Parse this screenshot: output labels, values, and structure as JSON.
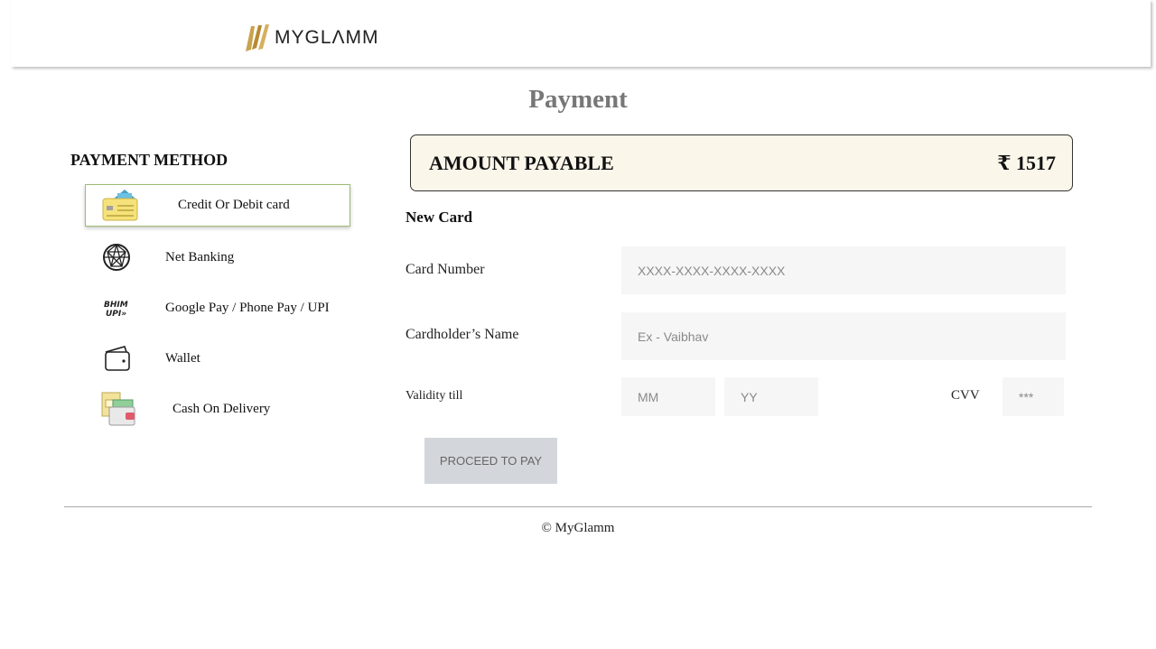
{
  "header": {
    "logo_text": "MYGLΛMM"
  },
  "page_title": "Payment",
  "payment_methods": {
    "heading": "PAYMENT METHOD",
    "items": [
      {
        "label": "Credit Or Debit card",
        "icon": "credit-card-icon",
        "active": true
      },
      {
        "label": "Net Banking",
        "icon": "globe-network-icon",
        "active": false
      },
      {
        "label": "Google Pay / Phone Pay / UPI",
        "icon": "bhim-upi-icon",
        "active": false
      },
      {
        "label": "Wallet",
        "icon": "wallet-icon",
        "active": false
      },
      {
        "label": "Cash On Delivery",
        "icon": "cash-on-delivery-icon",
        "active": false
      }
    ],
    "active_border_color": "#9dbb74"
  },
  "amount": {
    "label": "AMOUNT PAYABLE",
    "value": "₹ 1517",
    "background": "#fbf6ea"
  },
  "card_form": {
    "heading": "New Card",
    "card_number": {
      "label": "Card Number",
      "placeholder": "XXXX-XXXX-XXXX-XXXX"
    },
    "cardholder": {
      "label": "Cardholder’s Name",
      "placeholder": "Ex - Vaibhav"
    },
    "validity": {
      "label": "Validity till",
      "month_placeholder": "MM",
      "year_placeholder": "YY"
    },
    "cvv": {
      "label": "CVV",
      "placeholder": "***"
    },
    "submit_label": "PROCEED TO PAY"
  },
  "footer": {
    "copyright": "© MyGlamm"
  }
}
